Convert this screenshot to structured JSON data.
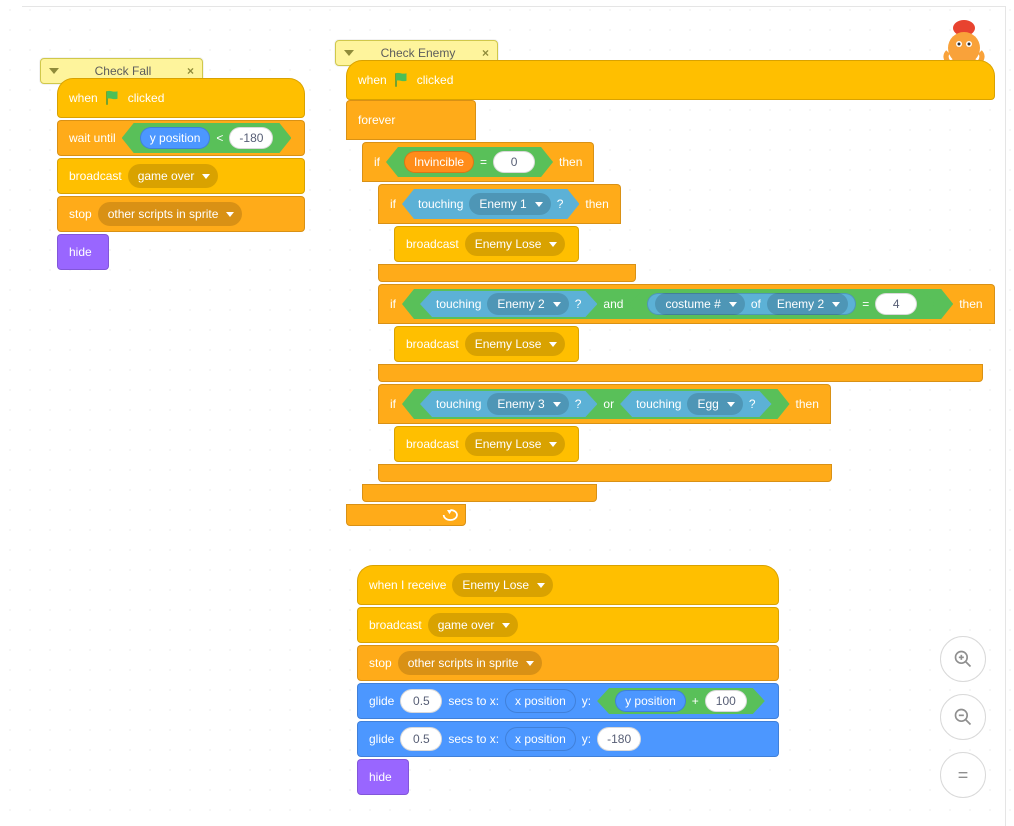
{
  "comments": {
    "check_fall": "Check Fall",
    "check_enemy": "Check Enemy"
  },
  "common": {
    "when_clicked": "clicked",
    "when": "when",
    "wait_until": "wait until",
    "broadcast": "broadcast",
    "stop": "stop",
    "hide": "hide",
    "forever": "forever",
    "if": "if",
    "then": "then",
    "touching": "touching",
    "and": "and",
    "or": "or",
    "of": "of",
    "when_receive": "when I receive",
    "glide": "glide",
    "secs_to_x": "secs to x:",
    "y_colon": "y:",
    "plus": "+",
    "equals": "=",
    "lt": "<",
    "q": "?"
  },
  "vars": {
    "y_position": "y position",
    "x_position": "x position",
    "invincible": "Invincible",
    "costume_num": "costume #"
  },
  "dropdowns": {
    "game_over": "game over",
    "other_scripts": "other scripts in sprite",
    "enemy1": "Enemy 1",
    "enemy2": "Enemy 2",
    "enemy3": "Enemy 3",
    "egg": "Egg",
    "enemy_lose": "Enemy Lose"
  },
  "values": {
    "neg180": "-180",
    "zero": "0",
    "four": "4",
    "half": "0.5",
    "hundred": "100"
  },
  "zoom": {
    "in": "+",
    "out": "−",
    "eq": "="
  }
}
